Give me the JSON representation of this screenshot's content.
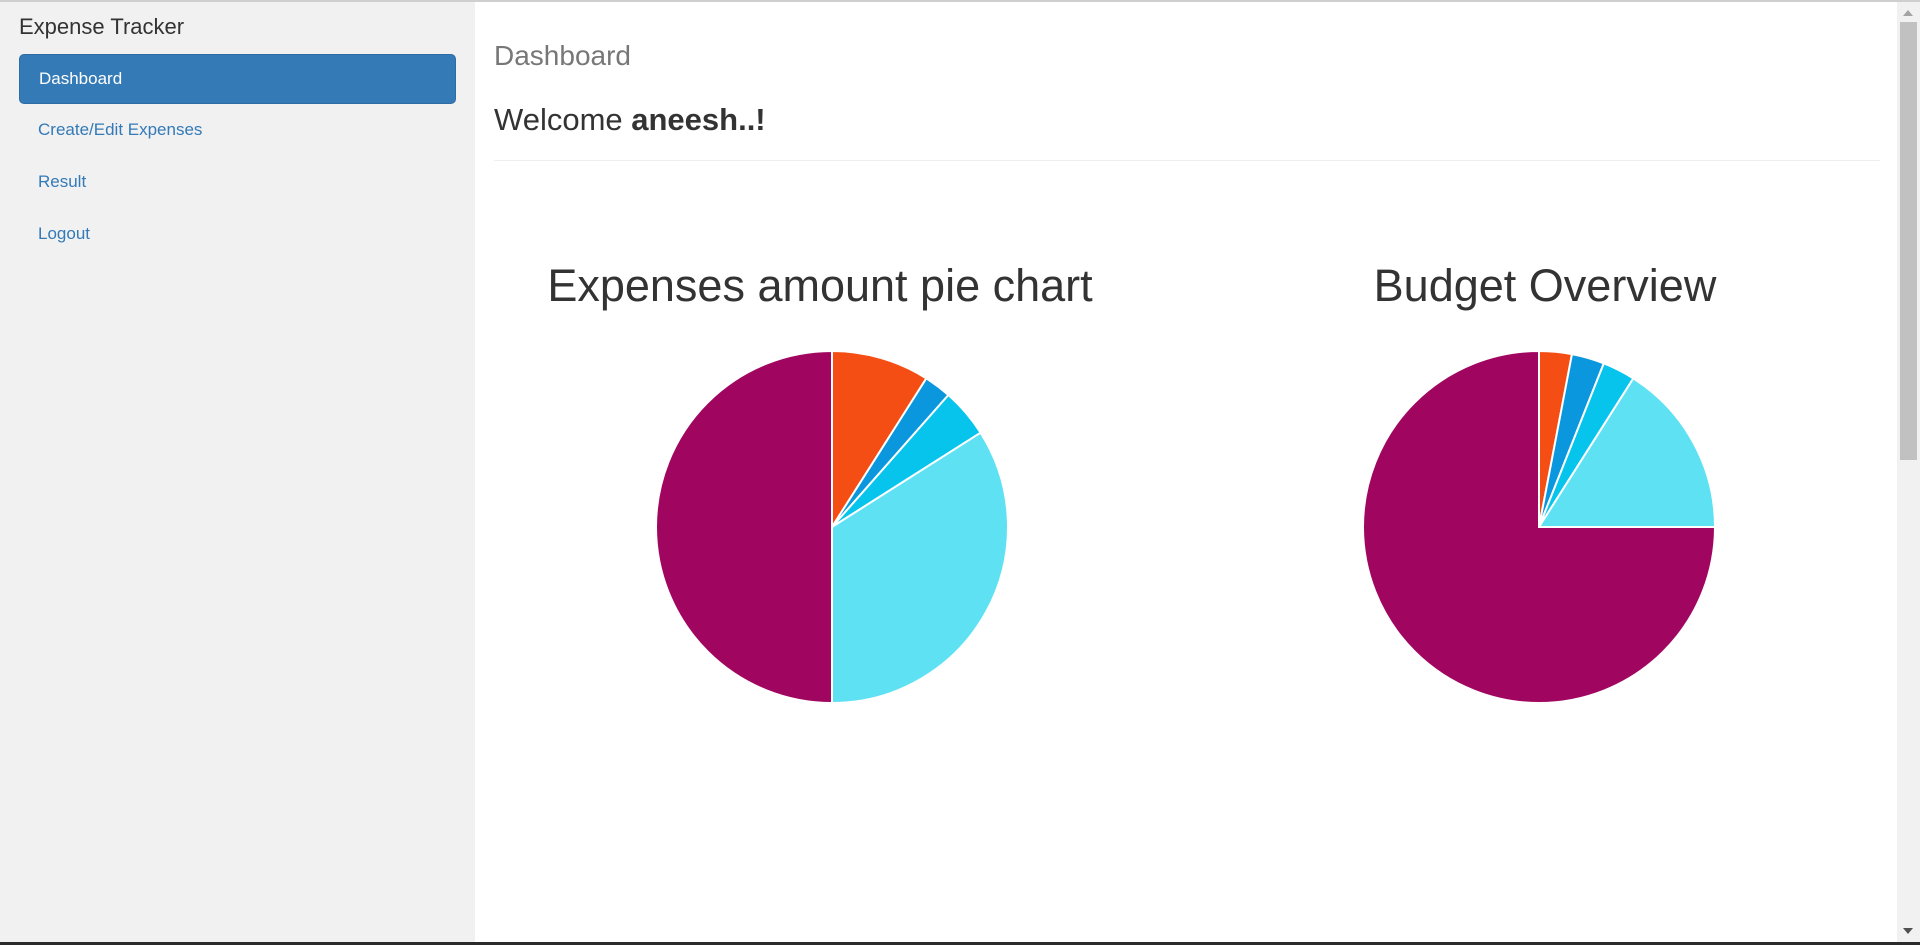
{
  "sidebar": {
    "brand": "Expense Tracker",
    "items": [
      {
        "label": "Dashboard",
        "active": true
      },
      {
        "label": "Create/Edit Expenses",
        "active": false
      },
      {
        "label": "Result",
        "active": false
      },
      {
        "label": "Logout",
        "active": false
      }
    ]
  },
  "main": {
    "page_title": "Dashboard",
    "welcome_prefix": "Welcome ",
    "welcome_user": "aneesh..!"
  },
  "colors": {
    "accent": "#337ab7",
    "slice_colors": [
      "#f44e14",
      "#0b97dd",
      "#06c4ec",
      "#5fe1f4",
      "#a00660"
    ]
  },
  "chart_data": [
    {
      "type": "pie",
      "title": "Expenses amount pie chart",
      "values": [
        9,
        2.5,
        4.5,
        34,
        50
      ],
      "colors": [
        "#f44e14",
        "#0b97dd",
        "#06c4ec",
        "#5fe1f4",
        "#a00660"
      ]
    },
    {
      "type": "pie",
      "title": "Budget Overview",
      "values": [
        3,
        3,
        3,
        16,
        75
      ],
      "colors": [
        "#f44e14",
        "#0b97dd",
        "#06c4ec",
        "#5fe1f4",
        "#a00660"
      ]
    }
  ]
}
